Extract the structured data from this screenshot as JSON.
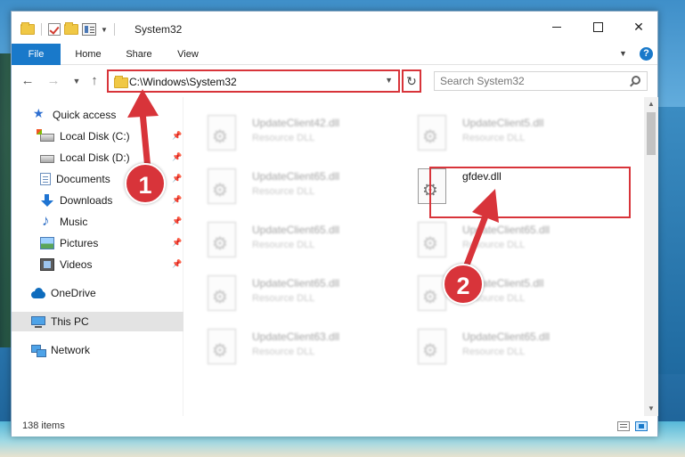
{
  "window": {
    "title": "System32"
  },
  "ribbon": {
    "tabs": [
      "File",
      "Home",
      "Share",
      "View"
    ]
  },
  "address": {
    "path": "C:\\Windows\\System32"
  },
  "search": {
    "placeholder": "Search System32"
  },
  "sidebar": {
    "quick_access": "Quick access",
    "items": [
      {
        "label": "Local Disk (C:)",
        "icon": "local-disk-icon"
      },
      {
        "label": "Local Disk (D:)",
        "icon": "local-disk-icon"
      },
      {
        "label": "Documents",
        "icon": "documents-icon"
      },
      {
        "label": "Downloads",
        "icon": "downloads-icon"
      },
      {
        "label": "Music",
        "icon": "music-icon"
      },
      {
        "label": "Pictures",
        "icon": "pictures-icon"
      },
      {
        "label": "Videos",
        "icon": "videos-icon"
      }
    ],
    "onedrive": "OneDrive",
    "this_pc": "This PC",
    "network": "Network"
  },
  "files": [
    {
      "name": "UpdateClient42.dll",
      "type": "Resource DLL"
    },
    {
      "name": "UpdateClient5.dll",
      "type": "Resource DLL"
    },
    {
      "name": "UpdateClient65.dll",
      "type": "Resource DLL"
    },
    {
      "name": "gfdev.dll",
      "type": ""
    },
    {
      "name": "UpdateClient65.dll",
      "type": "Resource DLL"
    },
    {
      "name": "UpdateClient65.dll",
      "type": "Resource DLL"
    },
    {
      "name": "UpdateClient65.dll",
      "type": "Resource DLL"
    },
    {
      "name": "UpdateClient5.dll",
      "type": "Resource DLL"
    },
    {
      "name": "UpdateClient63.dll",
      "type": "Resource DLL"
    },
    {
      "name": "UpdateClient65.dll",
      "type": "Resource DLL"
    }
  ],
  "status": {
    "count": "138 items"
  },
  "annotations": {
    "step1": "1",
    "step2": "2"
  },
  "colors": {
    "accent": "#1979ca",
    "highlight_red": "#d8343a",
    "selected_bg": "#e3e3e3"
  }
}
